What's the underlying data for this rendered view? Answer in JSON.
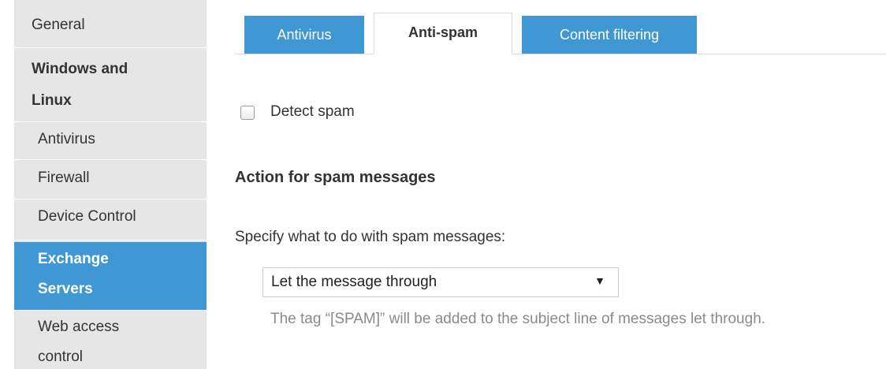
{
  "sidebar": {
    "items": [
      {
        "line1": "General",
        "line2": ""
      },
      {
        "line1": "Windows and",
        "line2": "Linux"
      },
      {
        "line1": "Antivirus",
        "line2": ""
      },
      {
        "line1": "Firewall",
        "line2": ""
      },
      {
        "line1": "Device Control",
        "line2": ""
      },
      {
        "line1": "Exchange",
        "line2": "Servers"
      },
      {
        "line1": "Web access",
        "line2": "control"
      }
    ],
    "active_color": "#3f97d3"
  },
  "tabs": [
    {
      "label": "Antivirus",
      "state": "inactive"
    },
    {
      "label": "Anti-spam",
      "state": "active"
    },
    {
      "label": "Content filtering",
      "state": "inactive"
    }
  ],
  "content": {
    "detect_spam_label": "Detect spam",
    "detect_spam_checked": false,
    "section_title": "Action for spam messages",
    "specify_label": "Specify what to do with spam messages:",
    "action_select": {
      "value": "Let the message through",
      "arrow": "▼"
    },
    "hint": "The tag “[SPAM]” will be added to the subject line of messages let through."
  }
}
